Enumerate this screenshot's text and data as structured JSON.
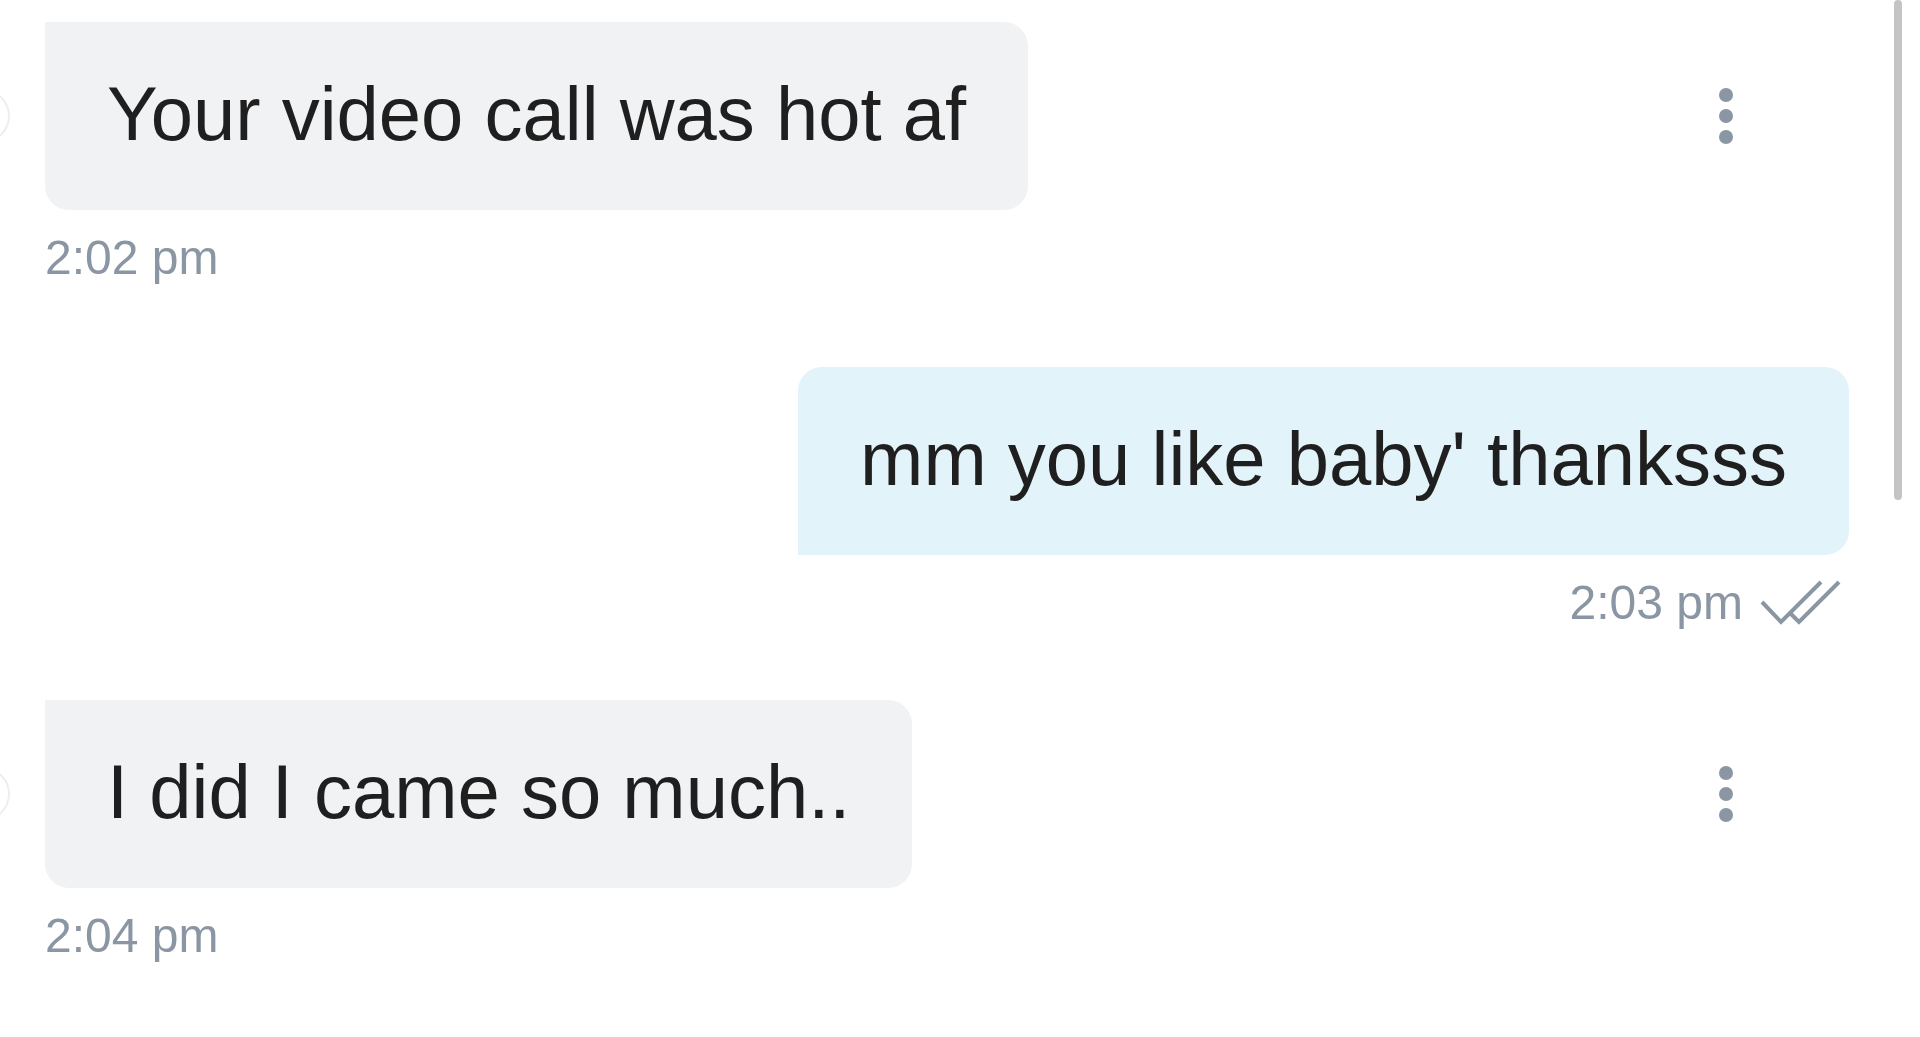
{
  "messages": [
    {
      "kind": "incoming",
      "text": "Your video call was hot af",
      "time": "2:02 pm"
    },
    {
      "kind": "outgoing",
      "text": "mm you like baby' thanksss",
      "time": "2:03 pm"
    },
    {
      "kind": "incoming",
      "text": "I did I came so much..",
      "time": "2:04 pm"
    }
  ]
}
